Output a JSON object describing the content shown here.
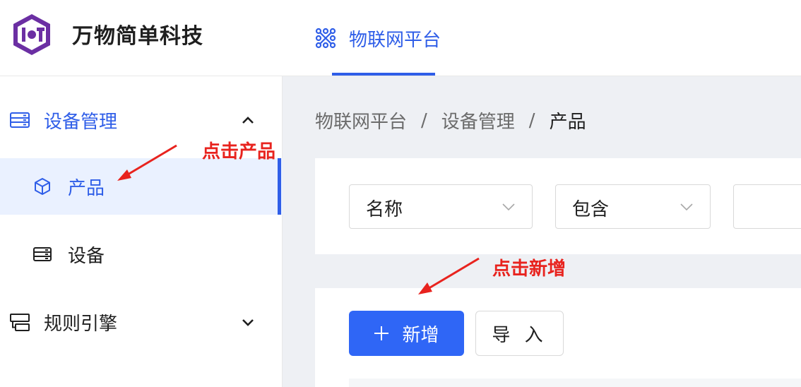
{
  "header": {
    "brand": "万物简单科技",
    "nav_tab_label": "物联网平台",
    "accent_color": "#2f5ee8",
    "logo_icon": "iot-hexagon-logo-icon",
    "nav_icon": "network-grid-icon"
  },
  "sidebar": {
    "groups": [
      {
        "label": "设备管理",
        "icon": "server-icon",
        "expanded": true,
        "items": [
          {
            "label": "产品",
            "icon": "cube-icon",
            "active": true
          },
          {
            "label": "设备",
            "icon": "server-icon",
            "active": false
          }
        ]
      },
      {
        "label": "规则引擎",
        "icon": "rules-icon",
        "expanded": false
      }
    ]
  },
  "breadcrumb": {
    "items": [
      "物联网平台",
      "设备管理",
      "产品"
    ],
    "separator": "/"
  },
  "filter": {
    "field_value": "名称",
    "operator_value": "包含",
    "value_text": ""
  },
  "actions": {
    "add_label": "新增",
    "import_label": "导 入"
  },
  "annotations": {
    "click_product": "点击产品",
    "click_add": "点击新增",
    "color": "#e8231e"
  }
}
